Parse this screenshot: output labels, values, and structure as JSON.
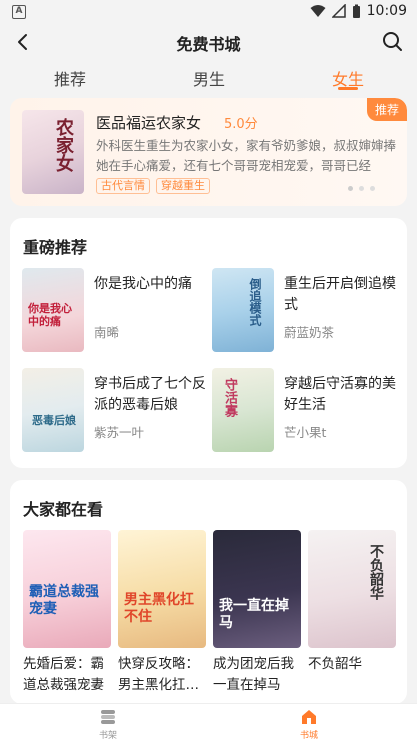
{
  "status_bar": {
    "time": "10:09",
    "app_indicator": "A"
  },
  "header": {
    "title": "免费书城",
    "back_icon": "back-arrow-icon",
    "search_icon": "search-icon"
  },
  "tabs": [
    {
      "label": "推荐"
    },
    {
      "label": "男生"
    },
    {
      "label": "女生",
      "active": true
    }
  ],
  "banner": {
    "badge": "推荐",
    "title": "医品福运农家女",
    "score": "5.0分",
    "desc": "外科医生重生为农家小女，家有爷奶爹娘，叔叔婶婶捧她在手心痛爱，还有七个哥哥宠相宠爱，哥哥已经够……",
    "tags": [
      "古代言情",
      "穿越重生"
    ],
    "cover_text": "农家女"
  },
  "recommend": {
    "title": "重磅推荐",
    "items": [
      {
        "name": "你是我心中的痛",
        "author": "南晞",
        "cover_text": "你是我心中的痛"
      },
      {
        "name": "重生后开启倒追模式",
        "author": "蔚蓝奶茶",
        "cover_text": "倒追模式"
      },
      {
        "name": "穿书后成了七个反派的恶毒后娘",
        "author": "紫苏一叶",
        "cover_text": "恶毒后娘"
      },
      {
        "name": "穿越后守活寡的美好生活",
        "author": "芒小果t",
        "cover_text": "守活寡"
      }
    ]
  },
  "popular": {
    "title": "大家都在看",
    "items": [
      {
        "name": "先婚后爱：霸道总裁强宠妻",
        "cover_text": "霸道总裁强宠妻"
      },
      {
        "name": "快穿反攻略：男主黑化扛…",
        "cover_text": "男主黑化扛不住"
      },
      {
        "name": "成为团宠后我一直在掉马",
        "cover_text": "我一直在掉马"
      },
      {
        "name": "不负韶华",
        "cover_text": "不负韶华"
      }
    ]
  },
  "bottom_nav": [
    {
      "label": "书架"
    },
    {
      "label": "书城",
      "active": true
    }
  ],
  "colors": {
    "accent": "#ff7a2a",
    "background": "#f3f3f3"
  }
}
